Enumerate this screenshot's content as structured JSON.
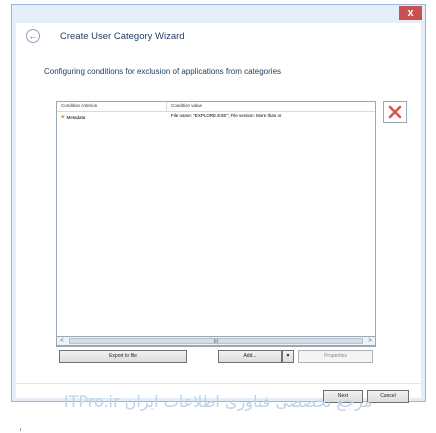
{
  "window": {
    "close_label": "x",
    "title": "Create User Category Wizard"
  },
  "header": {
    "text": "Configuring conditions for exclusion of applications from categories"
  },
  "table": {
    "columns": [
      "Condition criterion",
      "Condition value"
    ],
    "rows": [
      {
        "criterion": "Metadata",
        "value": "File name: \"EXPLORE.EXE\"; File version: More than or"
      }
    ]
  },
  "scrollbar": {
    "left": "<",
    "thumb": "III",
    "right": ">"
  },
  "buttons": {
    "export": "Export to file",
    "add": "Add...",
    "add_dropdown": "▼",
    "properties": "Properties",
    "next": "Next",
    "cancel": "Cancel"
  },
  "watermark": {
    "text": "ITPro.ir مرجع تخصصی فناوری اطلاعات ایران"
  },
  "colors": {
    "accent": "#1e3a5f",
    "delete_icon": "#d9534f"
  }
}
